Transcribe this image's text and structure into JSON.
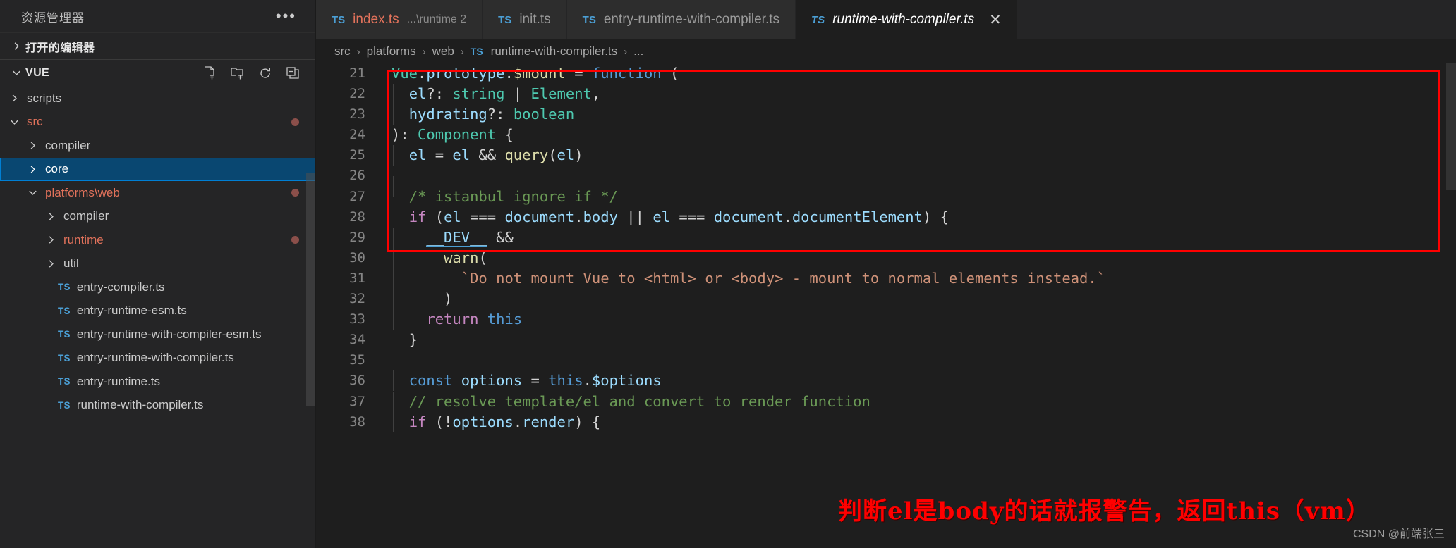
{
  "sidebar": {
    "title": "资源管理器",
    "more_icon": "ellipsis-icon",
    "open_editors_label": "打开的编辑器",
    "workspace_label": "VUE",
    "actions": [
      {
        "name": "new-file-icon",
        "title": "新建文件"
      },
      {
        "name": "new-folder-icon",
        "title": "新建文件夹"
      },
      {
        "name": "refresh-icon",
        "title": "刷新资源管理器"
      },
      {
        "name": "collapse-all-icon",
        "title": "在资源管理器中折叠文件夹"
      }
    ],
    "tree": [
      {
        "label": "scripts",
        "kind": "folder",
        "depth": 1,
        "expanded": false,
        "modified": false,
        "selected": false
      },
      {
        "label": "src",
        "kind": "folder",
        "depth": 1,
        "expanded": true,
        "modified": true,
        "selected": false
      },
      {
        "label": "compiler",
        "kind": "folder",
        "depth": 2,
        "expanded": false,
        "modified": false,
        "selected": false
      },
      {
        "label": "core",
        "kind": "folder",
        "depth": 2,
        "expanded": false,
        "modified": false,
        "selected": true
      },
      {
        "label": "platforms\\web",
        "kind": "folder",
        "depth": 2,
        "expanded": true,
        "modified": true,
        "selected": false
      },
      {
        "label": "compiler",
        "kind": "folder",
        "depth": 3,
        "expanded": false,
        "modified": false,
        "selected": false
      },
      {
        "label": "runtime",
        "kind": "folder",
        "depth": 3,
        "expanded": false,
        "modified": true,
        "selected": false
      },
      {
        "label": "util",
        "kind": "folder",
        "depth": 3,
        "expanded": false,
        "modified": false,
        "selected": false
      },
      {
        "label": "entry-compiler.ts",
        "kind": "ts",
        "depth": 3,
        "expanded": false,
        "modified": false,
        "selected": false
      },
      {
        "label": "entry-runtime-esm.ts",
        "kind": "ts",
        "depth": 3,
        "expanded": false,
        "modified": false,
        "selected": false
      },
      {
        "label": "entry-runtime-with-compiler-esm.ts",
        "kind": "ts",
        "depth": 3,
        "expanded": false,
        "modified": false,
        "selected": false
      },
      {
        "label": "entry-runtime-with-compiler.ts",
        "kind": "ts",
        "depth": 3,
        "expanded": false,
        "modified": false,
        "selected": false
      },
      {
        "label": "entry-runtime.ts",
        "kind": "ts",
        "depth": 3,
        "expanded": false,
        "modified": false,
        "selected": false
      },
      {
        "label": "runtime-with-compiler.ts",
        "kind": "ts",
        "depth": 3,
        "expanded": false,
        "modified": false,
        "selected": false
      }
    ]
  },
  "tabs": [
    {
      "name": "index.ts",
      "desc": "...\\runtime 2",
      "badge": "TS",
      "active": false,
      "modified": true,
      "close": ""
    },
    {
      "name": "init.ts",
      "desc": "",
      "badge": "TS",
      "active": false,
      "modified": false,
      "close": ""
    },
    {
      "name": "entry-runtime-with-compiler.ts",
      "desc": "",
      "badge": "TS",
      "active": false,
      "modified": false,
      "close": ""
    },
    {
      "name": "runtime-with-compiler.ts",
      "desc": "",
      "badge": "TS",
      "active": true,
      "modified": false,
      "close": "✕"
    }
  ],
  "breadcrumb": {
    "badge": "TS",
    "items": [
      "src",
      "platforms",
      "web",
      "runtime-with-compiler.ts",
      "..."
    ],
    "separator": "›"
  },
  "editor": {
    "lines": [
      {
        "num": "21",
        "tokens": [
          {
            "t": "Vue",
            "c": "t-green"
          },
          {
            "t": ".",
            "c": "t-plain"
          },
          {
            "t": "prototype",
            "c": "t-lblue"
          },
          {
            "t": ".",
            "c": "t-plain"
          },
          {
            "t": "$mount",
            "c": "t-yellow"
          },
          {
            "t": " = ",
            "c": "t-plain"
          },
          {
            "t": "function",
            "c": "t-blue"
          },
          {
            "t": " (",
            "c": "t-plain"
          }
        ],
        "indent": 0
      },
      {
        "num": "22",
        "tokens": [
          {
            "t": "  ",
            "c": "t-plain"
          },
          {
            "t": "el",
            "c": "t-lblue"
          },
          {
            "t": "?: ",
            "c": "t-plain"
          },
          {
            "t": "string",
            "c": "t-green"
          },
          {
            "t": " | ",
            "c": "t-plain"
          },
          {
            "t": "Element",
            "c": "t-green"
          },
          {
            "t": ",",
            "c": "t-plain"
          }
        ],
        "indent": 1
      },
      {
        "num": "23",
        "tokens": [
          {
            "t": "  ",
            "c": "t-plain"
          },
          {
            "t": "hydrating",
            "c": "t-lblue"
          },
          {
            "t": "?: ",
            "c": "t-plain"
          },
          {
            "t": "boolean",
            "c": "t-green"
          }
        ],
        "indent": 1
      },
      {
        "num": "24",
        "tokens": [
          {
            "t": "): ",
            "c": "t-plain"
          },
          {
            "t": "Component",
            "c": "t-green"
          },
          {
            "t": " {",
            "c": "t-plain"
          }
        ],
        "indent": 0
      },
      {
        "num": "25",
        "tokens": [
          {
            "t": "  ",
            "c": "t-plain"
          },
          {
            "t": "el",
            "c": "t-lblue"
          },
          {
            "t": " = ",
            "c": "t-plain"
          },
          {
            "t": "el",
            "c": "t-lblue"
          },
          {
            "t": " && ",
            "c": "t-plain"
          },
          {
            "t": "query",
            "c": "t-yellow"
          },
          {
            "t": "(",
            "c": "t-plain"
          },
          {
            "t": "el",
            "c": "t-lblue"
          },
          {
            "t": ")",
            "c": "t-plain"
          }
        ],
        "indent": 1
      },
      {
        "num": "26",
        "tokens": [],
        "indent": 1
      },
      {
        "num": "27",
        "tokens": [
          {
            "t": "  ",
            "c": "t-plain"
          },
          {
            "t": "/* istanbul ignore if */",
            "c": "t-comment"
          }
        ],
        "indent": 0
      },
      {
        "num": "28",
        "tokens": [
          {
            "t": "  ",
            "c": "t-plain"
          },
          {
            "t": "if",
            "c": "t-purple"
          },
          {
            "t": " (",
            "c": "t-plain"
          },
          {
            "t": "el",
            "c": "t-lblue"
          },
          {
            "t": " === ",
            "c": "t-plain"
          },
          {
            "t": "document",
            "c": "t-lblue"
          },
          {
            "t": ".",
            "c": "t-plain"
          },
          {
            "t": "body",
            "c": "t-lblue"
          },
          {
            "t": " || ",
            "c": "t-plain"
          },
          {
            "t": "el",
            "c": "t-lblue"
          },
          {
            "t": " === ",
            "c": "t-plain"
          },
          {
            "t": "document",
            "c": "t-lblue"
          },
          {
            "t": ".",
            "c": "t-plain"
          },
          {
            "t": "documentElement",
            "c": "t-lblue"
          },
          {
            "t": ") {",
            "c": "t-plain"
          }
        ],
        "indent": 0
      },
      {
        "num": "29",
        "tokens": [
          {
            "t": "    ",
            "c": "t-plain"
          },
          {
            "t": "__DEV__",
            "c": "t-lblue-u"
          },
          {
            "t": " &&",
            "c": "t-plain"
          }
        ],
        "indent": 1
      },
      {
        "num": "30",
        "tokens": [
          {
            "t": "      ",
            "c": "t-plain"
          },
          {
            "t": "warn",
            "c": "t-yellow"
          },
          {
            "t": "(",
            "c": "t-plain"
          }
        ],
        "indent": 1
      },
      {
        "num": "31",
        "tokens": [
          {
            "t": "        ",
            "c": "t-plain"
          },
          {
            "t": "`Do not mount Vue to <html> or <body> - mount to normal elements instead.`",
            "c": "t-orange"
          }
        ],
        "indent": 2
      },
      {
        "num": "32",
        "tokens": [
          {
            "t": "      )",
            "c": "t-plain"
          }
        ],
        "indent": 1
      },
      {
        "num": "33",
        "tokens": [
          {
            "t": "    ",
            "c": "t-plain"
          },
          {
            "t": "return",
            "c": "t-purple"
          },
          {
            "t": " ",
            "c": "t-plain"
          },
          {
            "t": "this",
            "c": "t-blue"
          }
        ],
        "indent": 1
      },
      {
        "num": "34",
        "tokens": [
          {
            "t": "  }",
            "c": "t-plain"
          }
        ],
        "indent": 0
      },
      {
        "num": "35",
        "tokens": [],
        "indent": 0
      },
      {
        "num": "36",
        "tokens": [
          {
            "t": "  ",
            "c": "t-plain"
          },
          {
            "t": "const",
            "c": "t-blue"
          },
          {
            "t": " ",
            "c": "t-plain"
          },
          {
            "t": "options",
            "c": "t-lblue"
          },
          {
            "t": " = ",
            "c": "t-plain"
          },
          {
            "t": "this",
            "c": "t-blue"
          },
          {
            "t": ".",
            "c": "t-plain"
          },
          {
            "t": "$options",
            "c": "t-lblue"
          }
        ],
        "indent": 1
      },
      {
        "num": "37",
        "tokens": [
          {
            "t": "  ",
            "c": "t-plain"
          },
          {
            "t": "// resolve template/el and convert to render function",
            "c": "t-comment"
          }
        ],
        "indent": 1
      },
      {
        "num": "38",
        "tokens": [
          {
            "t": "  ",
            "c": "t-plain"
          },
          {
            "t": "if",
            "c": "t-purple"
          },
          {
            "t": " (!",
            "c": "t-plain"
          },
          {
            "t": "options",
            "c": "t-lblue"
          },
          {
            "t": ".",
            "c": "t-plain"
          },
          {
            "t": "render",
            "c": "t-lblue"
          },
          {
            "t": ") {",
            "c": "t-plain"
          }
        ],
        "indent": 1
      }
    ],
    "annotation": "判断el是body的话就报警告，返回this（vm）",
    "annotation_color": "#ff0000",
    "highlight_box_color": "#ff0000"
  },
  "watermark": "CSDN @前端张三"
}
